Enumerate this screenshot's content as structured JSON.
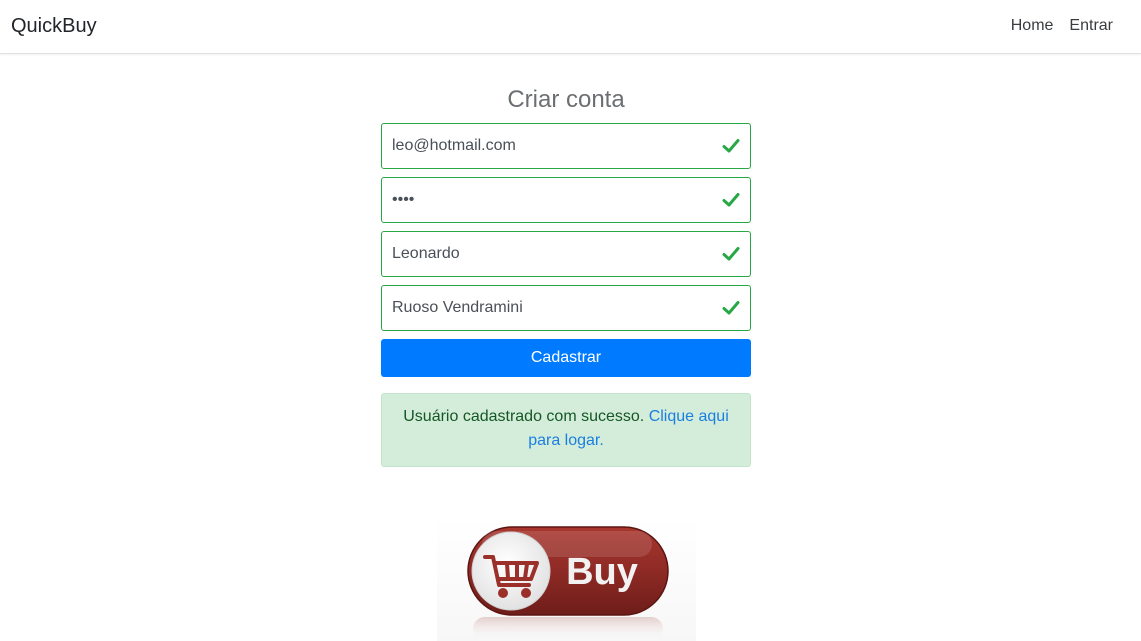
{
  "navbar": {
    "brand": "QuickBuy",
    "links": [
      {
        "label": "Home"
      },
      {
        "label": "Entrar"
      }
    ]
  },
  "form": {
    "title": "Criar conta",
    "fields": {
      "email": {
        "value": "leo@hotmail.com"
      },
      "password": {
        "value": "1234"
      },
      "first_name": {
        "value": "Leonardo"
      },
      "last_name": {
        "value": "Ruoso Vendramini"
      }
    },
    "submit_label": "Cadastrar"
  },
  "alert": {
    "message": "Usuário cadastrado com sucesso.",
    "link_text": "Clique aqui para logar."
  },
  "banner": {
    "label": "Buy",
    "icon": "shopping-cart-icon"
  },
  "colors": {
    "valid": "#28a745",
    "primary": "#007bff",
    "success_bg": "#d4edda",
    "banner_red": "#8e2a25"
  }
}
